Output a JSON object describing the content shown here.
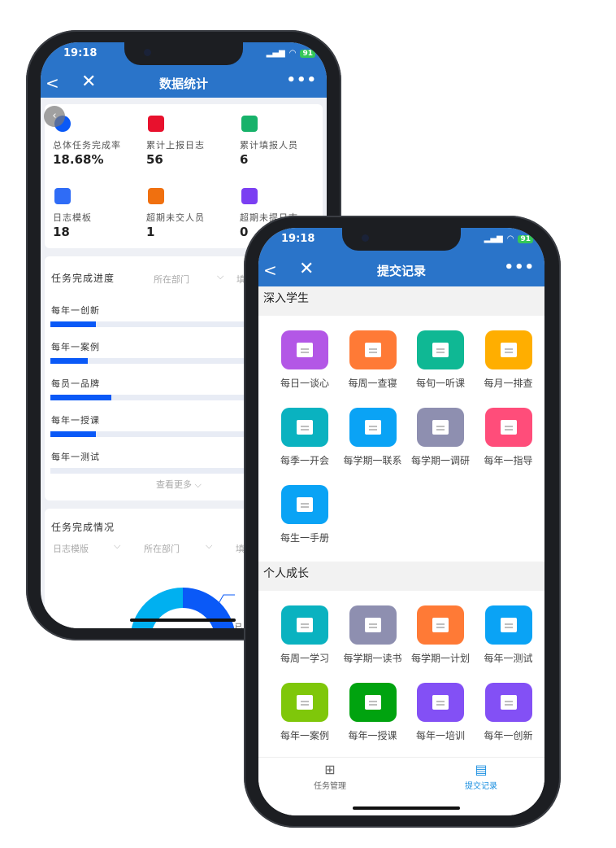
{
  "phone1": {
    "status": {
      "time": "19:18",
      "battery": "91"
    },
    "nav": {
      "back": "<",
      "close": "✕",
      "title": "数据统计",
      "more": "•••"
    },
    "stats": [
      {
        "icon": "pie-chart-icon",
        "color": "#0a59f7",
        "label": "总体任务完成率",
        "value": "18.68%"
      },
      {
        "icon": "report-icon",
        "color": "#e8112d",
        "label": "累计上报日志",
        "value": "56"
      },
      {
        "icon": "contact-card-icon",
        "color": "#17b26a",
        "label": "累计填报人员",
        "value": "6"
      },
      {
        "icon": "list-icon",
        "color": "#2f6cf6",
        "label": "日志模板",
        "value": "18"
      },
      {
        "icon": "user-warning-icon",
        "color": "#f0700f",
        "label": "超期未交人员",
        "value": "1"
      },
      {
        "icon": "bar-chart-icon",
        "color": "#7b3ff2",
        "label": "超期未提日志",
        "value": "0"
      }
    ],
    "progress": {
      "title": "任务完成进度",
      "filter1": "所在部门",
      "filter2": "填",
      "items": [
        {
          "label": "每年一创新",
          "fraction": 0.17
        },
        {
          "label": "每年一案例",
          "fraction": 0.14
        },
        {
          "label": "每员一品牌",
          "fraction": 0.23
        },
        {
          "label": "每年一授课",
          "fraction": 0.17
        },
        {
          "label": "每年一测试",
          "fraction": 0
        }
      ],
      "more": "查看更多"
    },
    "completion": {
      "title": "任务完成情况",
      "filter1": "日志模版",
      "filter2": "所在部门",
      "filter3": "填",
      "legend_label": "已",
      "legend_value": "18"
    },
    "colors": {
      "header": "#2a74c9",
      "bar": "#0a59f7",
      "donut_a": "#0a59f7",
      "donut_b": "#00b0f0"
    }
  },
  "phone2": {
    "status": {
      "time": "19:18",
      "battery": "91"
    },
    "nav": {
      "back": "<",
      "close": "✕",
      "title": "提交记录",
      "more": "•••"
    },
    "sections": [
      {
        "title": "深入学生",
        "items": [
          {
            "label": "每日一谈心",
            "color": "#b357e6"
          },
          {
            "label": "每周一查寝",
            "color": "#ff7a36"
          },
          {
            "label": "每旬一听课",
            "color": "#0fb894"
          },
          {
            "label": "每月一排查",
            "color": "#ffae00"
          },
          {
            "label": "每季一开会",
            "color": "#0ab2c0"
          },
          {
            "label": "每学期一联系",
            "color": "#0aa3f5"
          },
          {
            "label": "每学期一调研",
            "color": "#8e8fb0"
          },
          {
            "label": "每年一指导",
            "color": "#ff4d7a"
          },
          {
            "label": "每生一手册",
            "color": "#0aa3f5"
          }
        ]
      },
      {
        "title": "个人成长",
        "items": [
          {
            "label": "每周一学习",
            "color": "#0ab2c0"
          },
          {
            "label": "每学期一读书",
            "color": "#8e8fb0"
          },
          {
            "label": "每学期一计划",
            "color": "#ff7a36"
          },
          {
            "label": "每年一测试",
            "color": "#0aa3f5"
          },
          {
            "label": "每年一案例",
            "color": "#7fc70a"
          },
          {
            "label": "每年一授课",
            "color": "#00a30f"
          },
          {
            "label": "每年一培训",
            "color": "#8350f5"
          },
          {
            "label": "每年一创新",
            "color": "#8350f5"
          }
        ]
      }
    ],
    "tabs": [
      {
        "label": "任务管理",
        "icon": "grid-icon",
        "active": false
      },
      {
        "label": "提交记录",
        "icon": "calendar-icon",
        "active": true
      }
    ],
    "colors": {
      "active_tab": "#1a8fe0"
    }
  }
}
